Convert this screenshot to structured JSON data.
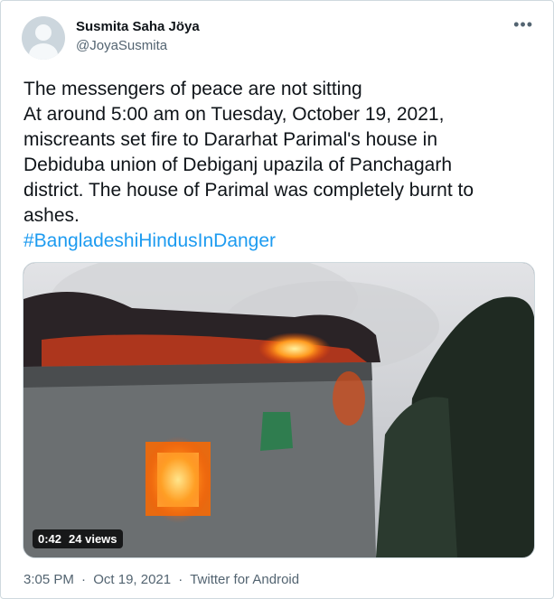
{
  "author": {
    "display_name": "Susmita Saha Jöya",
    "handle": "@JoyaSusmita"
  },
  "more_label": "•••",
  "tweet": {
    "lines": [
      "The messengers of peace are not sitting",
      "At around 5:00 am on Tuesday, October 19, 2021,",
      "miscreants set fire to Dararhat Parimal's house in",
      "Debiduba union of Debiganj upazila of Panchagarh",
      "district. The house of Parimal was completely burnt to",
      "ashes."
    ],
    "hashtag": "#BangladeshiHindusInDanger"
  },
  "video": {
    "duration": "0:42",
    "views": "24 views"
  },
  "footer": {
    "time": "3:05 PM",
    "date": "Oct 19, 2021",
    "source": "Twitter for Android",
    "separator": "·"
  },
  "colors": {
    "accent": "#1d9bf0",
    "text": "#0f1419",
    "muted": "#536471",
    "fire": "#ff8a1f"
  }
}
